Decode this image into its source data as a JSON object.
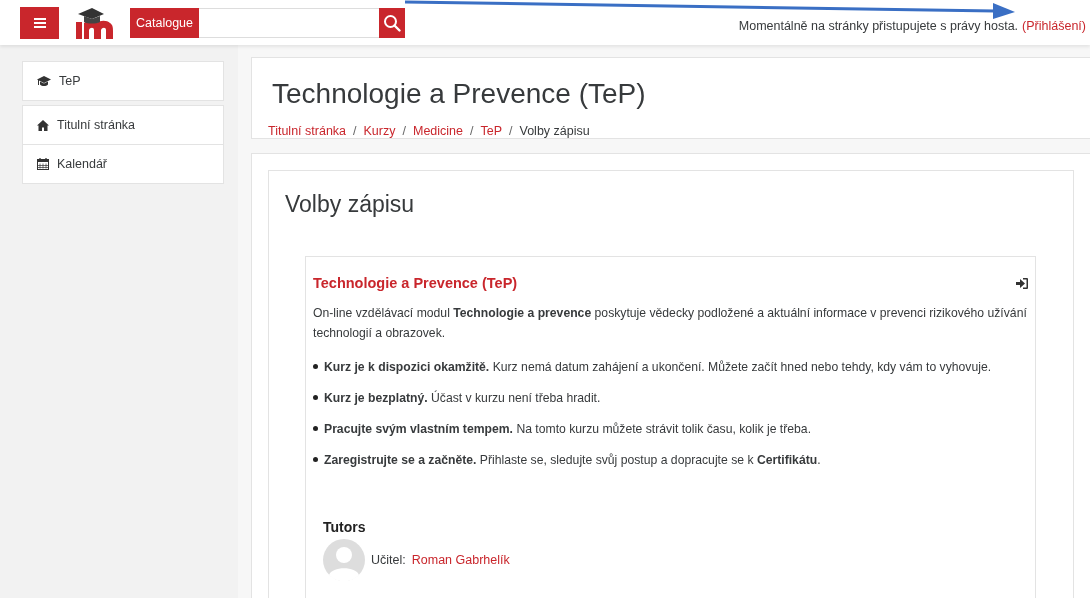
{
  "navbar": {
    "catalogue_label": "Catalogue",
    "login_text": "Momentálně na stránky přistupujete s právy hosta.",
    "login_link": "(Přihlášení)"
  },
  "sidebar": {
    "groups": [
      [
        {
          "label": "TeP"
        }
      ],
      [
        {
          "label": "Titulní stránka"
        },
        {
          "label": "Kalendář"
        }
      ]
    ]
  },
  "header": {
    "title": "Technologie a Prevence (TeP)",
    "separator": "/",
    "breadcrumb": [
      {
        "label": "Titulní stránka",
        "current": false
      },
      {
        "label": "Kurzy",
        "current": false
      },
      {
        "label": "Medicine",
        "current": false
      },
      {
        "label": "TeP",
        "current": false
      },
      {
        "label": "Volby zápisu",
        "current": true
      }
    ]
  },
  "main": {
    "heading": "Volby zápisu",
    "course": {
      "title": "Technologie a Prevence (TeP)",
      "summary": "On-line vzdělávací modul **Technologie a prevence** poskytuje vědecky podložené a aktuální informace v prevenci rizikového užívání technologií a obrazovek.",
      "bullets": [
        "**Kurz je k dispozici okamžitě.** Kurz nemá datum zahájení a ukončení. Můžete začít hned nebo tehdy, kdy vám to vyhovuje.",
        "**Kurz je bezplatný.** Účast v kurzu není třeba hradit.",
        "**Pracujte svým vlastním tempem.** Na tomto kurzu můžete strávit tolik času, kolik je třeba.",
        "**Zaregistrujte se a začněte.** Přihlaste se, sledujte svůj postup a dopracujte se k **Certifikátu**."
      ],
      "tutors_heading": "Tutors",
      "tutors": [
        {
          "role": "Učitel:",
          "name": "Roman Gabrhelík"
        }
      ]
    }
  }
}
